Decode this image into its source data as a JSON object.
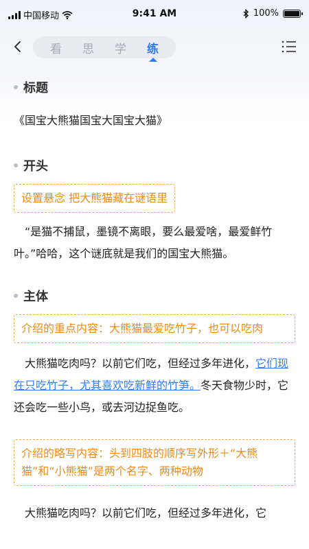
{
  "status_bar": {
    "carrier": "中国移动",
    "time": "9:41 AM",
    "battery": "100%",
    "battery_level": 1.0
  },
  "nav": {
    "tabs": [
      {
        "label": "看"
      },
      {
        "label": "思"
      },
      {
        "label": "学"
      },
      {
        "label": "练"
      }
    ],
    "active_tab": "练"
  },
  "sections": {
    "title": {
      "heading": "标题",
      "text": "《国宝大熊猫国宝大国宝大猫》"
    },
    "opening": {
      "heading": "开头",
      "tag": "设置悬念 把大熊猫藏在谜语里",
      "text": "“是猫不捕鼠，墨镜不离眼，要么最爱啥，最爱鲜竹叶。”哈哈，这个谜底就是我们的国宝大熊猫。"
    },
    "body": {
      "heading": "主体",
      "tag1": "介绍的重点内容：大熊猫最爱吃竹子，也可以吃肉",
      "para1_before": "大熊猫吃肉吗？以前它们吃，但经过多年进化，",
      "para1_link": "它们现在只吃竹子，尤其喜欢吃新鲜的竹笋。",
      "para1_after": "冬天食物少时，它还会吃一些小鸟，或去河边捉鱼吃。",
      "tag2": "介绍的略写内容：头到四肢的顺序写外形＋“大熊猫”和“小熊猫”是两个名字、两种动物",
      "para2": "大熊猫吃肉吗？以前它们吃，但经过多年进化，它"
    }
  }
}
